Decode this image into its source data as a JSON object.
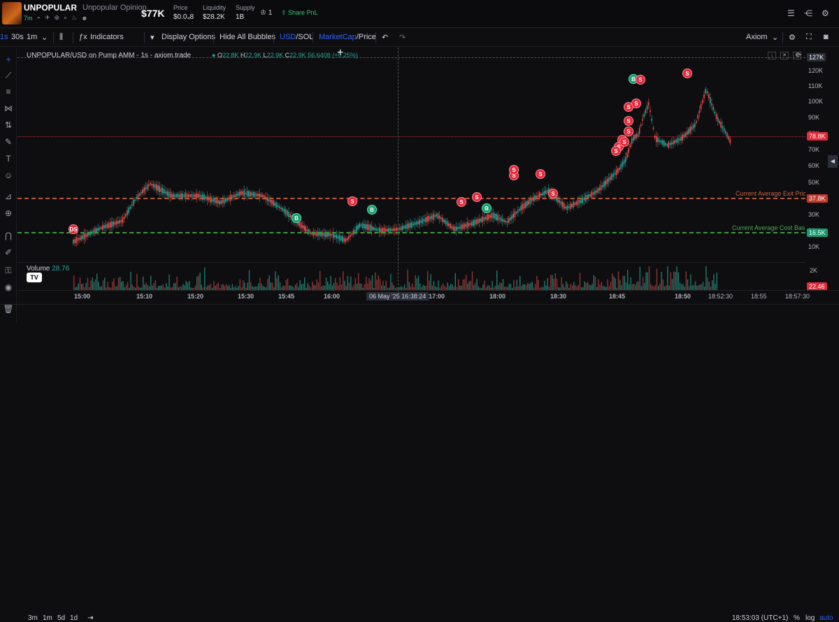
{
  "token": {
    "name": "UNPOPULAR",
    "full_name": "Unpopular Opinion",
    "age": "7m",
    "market_cap": "$77K"
  },
  "stats": {
    "price": {
      "label": "Price",
      "value": "$0.0₄8"
    },
    "liquidity": {
      "label": "Liquidity",
      "value": "$28.2K"
    },
    "supply": {
      "label": "Supply",
      "value": "1B"
    },
    "holders": "1",
    "share": "Share PnL"
  },
  "toolbar": {
    "intervals": [
      "1s",
      "30s",
      "1m"
    ],
    "indicators": "Indicators",
    "display_options": "Display Options",
    "hide_bubbles": "Hide All Bubbles",
    "usd": "USD",
    "sol": "SOL",
    "slash": "/",
    "marketcap": "MarketCap",
    "price": "Price",
    "source": "Axiom"
  },
  "chart": {
    "title": "UNPOPULAR/USD on Pump AMM - 1s - axiom.trade",
    "ohlc": {
      "o": "22.8K",
      "h": "22.9K",
      "l": "22.9K",
      "c": "22.9K 56.6408 (+0.25%)"
    },
    "price_labels": [
      "120K",
      "110K",
      "100K",
      "90K",
      "80K",
      "70K",
      "60K",
      "50K",
      "40K",
      "30K",
      "20K",
      "10K"
    ],
    "badges": [
      {
        "text": "127K",
        "color": "#2a2e39"
      },
      {
        "text": "78.8K",
        "color": "#e3283a"
      },
      {
        "text": "37.8K",
        "color": "#c0392b"
      },
      {
        "text": "16.5K",
        "color": "#169b6f"
      }
    ],
    "exit_label": "Current Average Exit Price",
    "cost_label": "Current Average Cost Basis",
    "volume_label": "Volume",
    "volume_value": "28.76",
    "volume_axis": "2K",
    "volume_badge": "22.46",
    "bubbles": [
      {
        "t": "DS",
        "k": "s"
      },
      {
        "t": "B",
        "k": "b"
      },
      {
        "t": "S",
        "k": "s"
      },
      {
        "t": "B",
        "k": "b"
      },
      {
        "t": "S",
        "k": "s"
      },
      {
        "t": "S",
        "k": "s"
      },
      {
        "t": "B",
        "k": "b"
      },
      {
        "t": "S",
        "k": "s"
      },
      {
        "t": "S",
        "k": "s"
      },
      {
        "t": "S",
        "k": "s"
      },
      {
        "t": "S",
        "k": "s"
      },
      {
        "t": "B",
        "k": "b"
      },
      {
        "t": "S",
        "k": "s"
      },
      {
        "t": "S",
        "k": "s"
      },
      {
        "t": "S",
        "k": "s"
      },
      {
        "t": "S",
        "k": "s"
      },
      {
        "t": "S",
        "k": "s"
      },
      {
        "t": "S",
        "k": "s"
      },
      {
        "t": "S",
        "k": "s"
      },
      {
        "t": "S",
        "k": "s"
      },
      {
        "t": "S",
        "k": "s"
      },
      {
        "t": "S",
        "k": "s"
      }
    ]
  },
  "time_axis": [
    "15:00",
    "15:10",
    "15:20",
    "15:30",
    "15:45",
    "16:00",
    "17:00",
    "18:00",
    "18:30",
    "18:45",
    "18:50",
    "18:52:30",
    "18:55",
    "18:57:30"
  ],
  "crosshair_time": "06 May '25  16:38:24",
  "bottom": {
    "ranges": [
      "3m",
      "1m",
      "5d",
      "1d"
    ],
    "clock": "18:53:03 (UTC+1)",
    "pct": "%",
    "log": "log",
    "auto": "auto"
  }
}
